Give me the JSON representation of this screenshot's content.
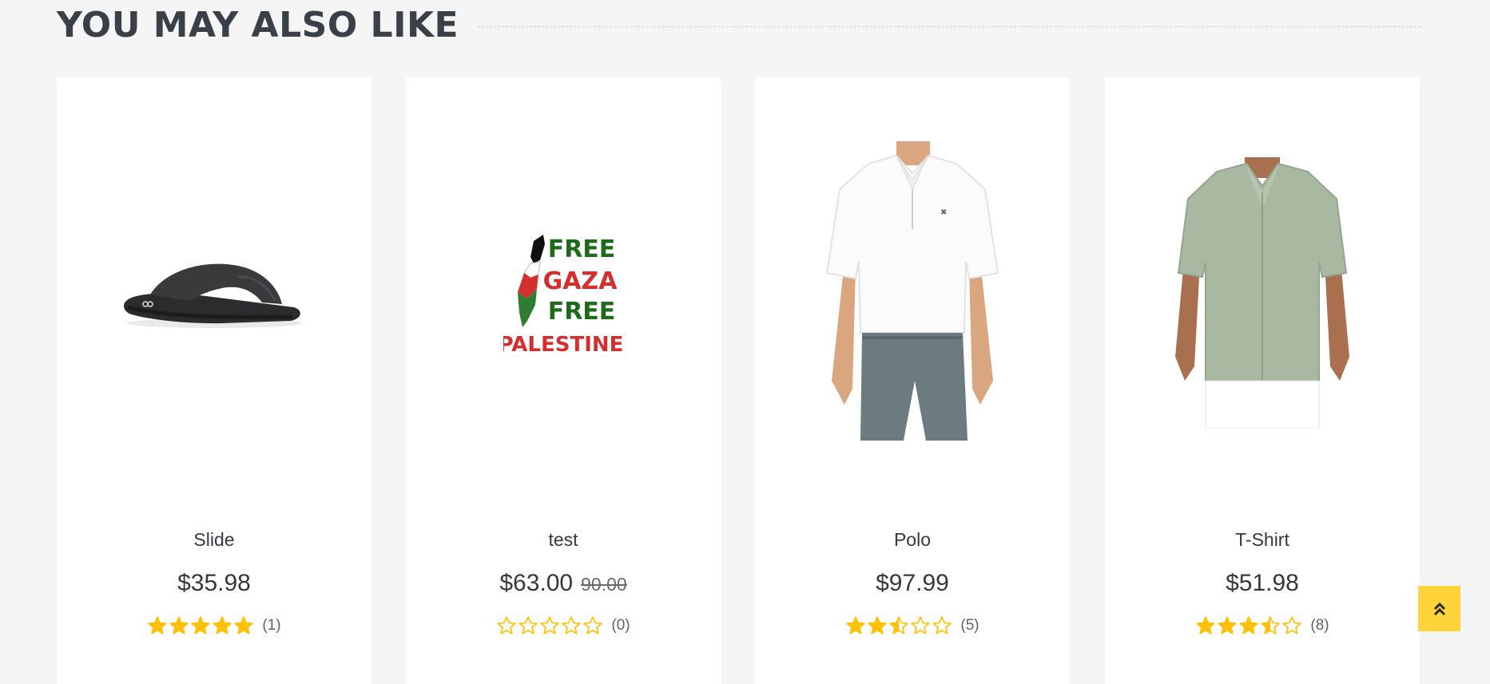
{
  "section": {
    "title": "YOU MAY ALSO LIKE"
  },
  "products": [
    {
      "name": "Slide",
      "price": "$35.98",
      "old_price": null,
      "rating": 5,
      "reviews": "(1)"
    },
    {
      "name": "test",
      "price": "$63.00",
      "old_price": "90.00",
      "rating": 0,
      "reviews": "(0)",
      "image_text": [
        "FREE",
        "GAZA",
        "FREE",
        "PALESTINE"
      ]
    },
    {
      "name": "Polo",
      "price": "$97.99",
      "old_price": null,
      "rating": 2.5,
      "reviews": "(5)"
    },
    {
      "name": "T-Shirt",
      "price": "$51.98",
      "old_price": null,
      "rating": 3.5,
      "reviews": "(8)"
    }
  ],
  "colors": {
    "star": "#ffc107",
    "scroll_button": "#ffd43b",
    "background": "#f5f5f5"
  },
  "icons": {
    "rating": "star-icon",
    "scroll_top": "double-chevron-up-icon"
  }
}
